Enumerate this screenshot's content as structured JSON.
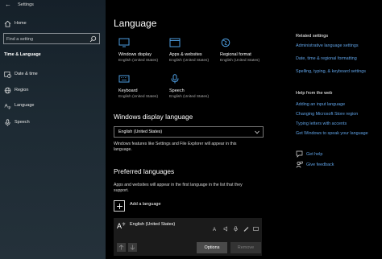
{
  "window": {
    "title": "Settings"
  },
  "sidebar": {
    "home_label": "Home",
    "search_placeholder": "Find a setting",
    "section_title": "Time & Language",
    "items": [
      {
        "label": "Date & time",
        "icon": "clock-calendar-icon"
      },
      {
        "label": "Region",
        "icon": "globe-icon"
      },
      {
        "label": "Language",
        "icon": "language-icon",
        "selected": true
      },
      {
        "label": "Speech",
        "icon": "microphone-icon"
      }
    ]
  },
  "main": {
    "title": "Language",
    "tiles": [
      {
        "name": "Windows display",
        "sub": "English (United States)",
        "icon": "monitor-icon"
      },
      {
        "name": "Apps & websites",
        "sub": "English (United States)",
        "icon": "app-window-icon"
      },
      {
        "name": "Regional format",
        "sub": "English (United States)",
        "icon": "globe-format-icon"
      },
      {
        "name": "Keyboard",
        "sub": "English (United States)",
        "icon": "keyboard-icon"
      },
      {
        "name": "Speech",
        "sub": "English (United States)",
        "icon": "microphone-icon"
      }
    ],
    "display_language": {
      "heading": "Windows display language",
      "selected": "English (United States)",
      "note_line1": "Windows features like Settings and File Explorer will appear in this",
      "note_line2": "language."
    },
    "preferred": {
      "heading": "Preferred languages",
      "note_line1": "Apps and websites will appear in the first language in the list that they",
      "note_line2": "support.",
      "add_label": "Add a language",
      "language_name": "English (United States)",
      "options_label": "Options",
      "remove_label": "Remove"
    }
  },
  "related": {
    "heading": "Related settings",
    "links": [
      "Administrative language settings",
      "Date, time & regional formatting",
      "Spelling, typing, & keyboard settings"
    ]
  },
  "help": {
    "heading": "Help from the web",
    "links": [
      "Adding an input language",
      "Changing Microsoft Store region",
      "Typing letters with accents",
      "Get Windows to speak your language"
    ],
    "get_help": "Get help",
    "give_feedback": "Give feedback"
  },
  "colors": {
    "accent": "#5fa2e6",
    "sidebar_bg": "#1d2a33",
    "main_bg": "#000000"
  }
}
